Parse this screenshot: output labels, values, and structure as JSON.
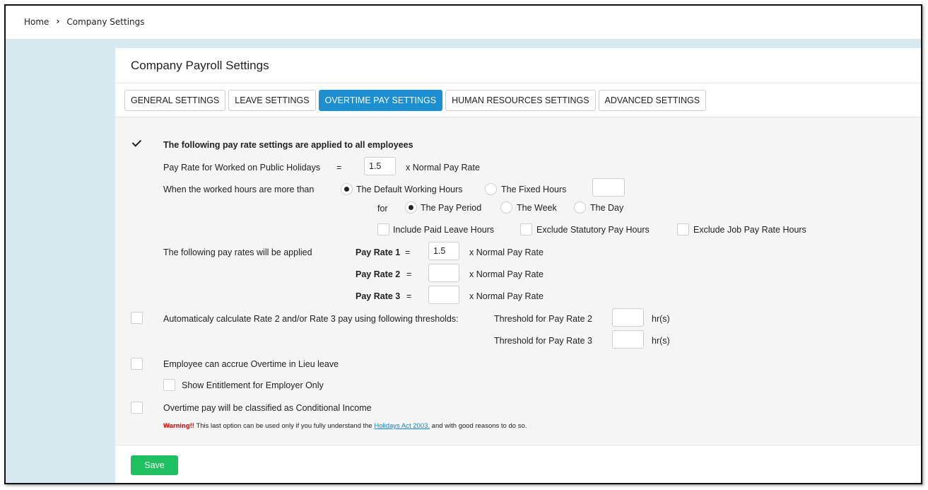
{
  "breadcrumb": {
    "home": "Home",
    "current": "Company Settings"
  },
  "card": {
    "title": "Company Payroll Settings"
  },
  "tabs": [
    {
      "label": "GENERAL SETTINGS"
    },
    {
      "label": "LEAVE SETTINGS"
    },
    {
      "label": "OVERTIME PAY SETTINGS"
    },
    {
      "label": "HUMAN RESOURCES SETTINGS"
    },
    {
      "label": "ADVANCED SETTINGS"
    }
  ],
  "active_tab": "OVERTIME PAY SETTINGS",
  "overtime": {
    "apply_all_label": "The following pay rate settings are applied to all employees",
    "apply_all_checked": true,
    "public_holidays_label": "Pay Rate for Worked on Public Holidays",
    "equals": "=",
    "public_holidays_value": "1.5",
    "x_normal_pay_rate": "x  Normal Pay Rate",
    "hours_more_than_label": "When the worked hours are more than",
    "default_working_hours": "The Default Working Hours",
    "fixed_hours": "The Fixed Hours",
    "fixed_hours_value": "",
    "for_label": "for",
    "pay_period": "The Pay Period",
    "week": "The Week",
    "day": "The Day",
    "include_paid_leave": "Include Paid Leave Hours",
    "exclude_statutory": "Exclude Statutory Pay Hours",
    "exclude_job_pay_rate": "Exclude Job Pay Rate Hours",
    "pay_rates_applied_label": "The following pay rates will be applied",
    "pay_rates": [
      {
        "label": "Pay Rate 1",
        "value": "1.5"
      },
      {
        "label": "Pay Rate 2",
        "value": ""
      },
      {
        "label": "Pay Rate 3",
        "value": ""
      }
    ],
    "auto_calc_label": "Automaticaly calculate Rate 2 and/or Rate 3 pay using following thresholds:",
    "threshold_2_label": "Threshold for Pay Rate 2",
    "threshold_3_label": "Threshold for Pay Rate 3",
    "threshold_2_value": "",
    "threshold_3_value": "",
    "hrs": "hr(s)",
    "lieu_label": "Employee can accrue Overtime in Lieu leave",
    "show_entitlement_label": "Show Entitlement for Employer Only",
    "conditional_income_label": "Overtime pay will be classified as Conditional Income",
    "warning_prefix": "Warning!!",
    "warning_text": " This last option can be used only if you fully understand the ",
    "warning_link": "Holidays Act 2003.",
    "warning_suffix": " and with good reasons to do so."
  },
  "footer": {
    "save_label": "Save"
  },
  "colors": {
    "accent": "#1b8fcf",
    "save": "#1fc061",
    "warning": "#d10000",
    "background": "#d9e9f0"
  }
}
